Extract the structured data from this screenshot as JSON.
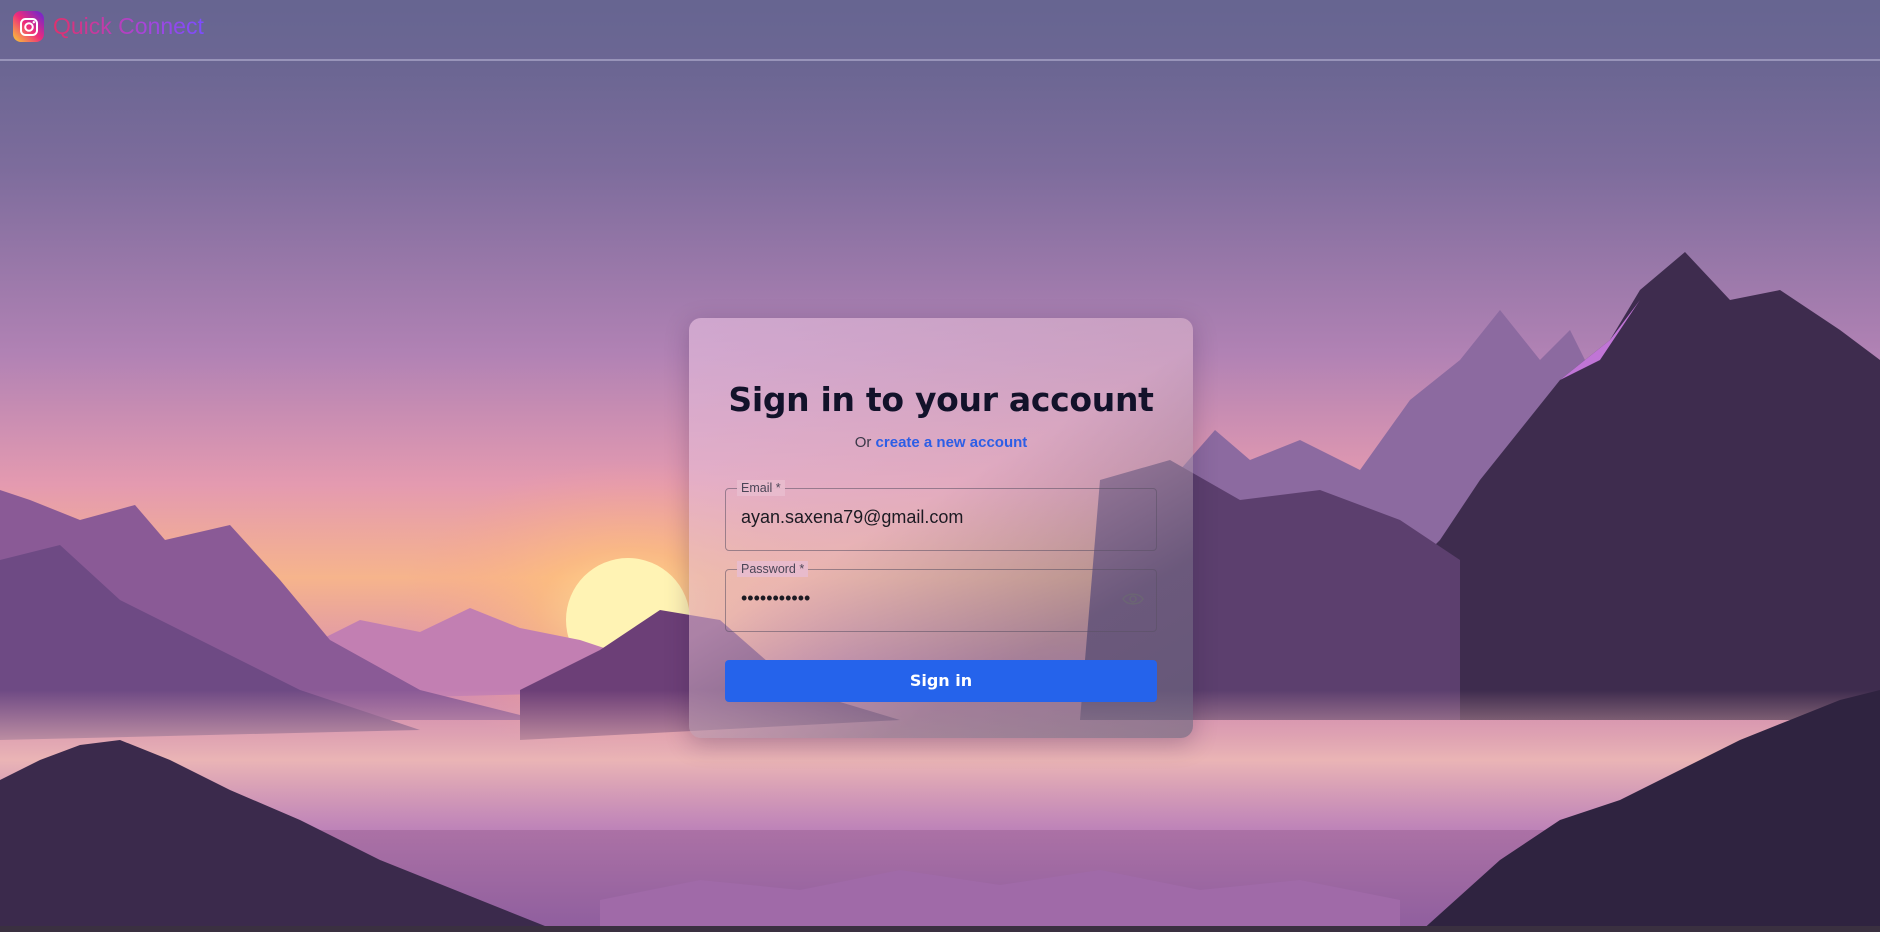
{
  "brand": {
    "name": "Quick Connect",
    "logo_icon": "camera-icon"
  },
  "form": {
    "title": "Sign in to your account",
    "subtitle_prefix": "Or",
    "create_account_link": "create a new account",
    "email": {
      "label": "Email *",
      "value": "ayan.saxena79@gmail.com"
    },
    "password": {
      "label": "Password *",
      "value": "•••••••••••",
      "toggle_icon": "eye-icon"
    },
    "submit_label": "Sign in"
  },
  "colors": {
    "accent": "#2563eb",
    "link": "#2c5ee6",
    "title": "#12122a"
  }
}
